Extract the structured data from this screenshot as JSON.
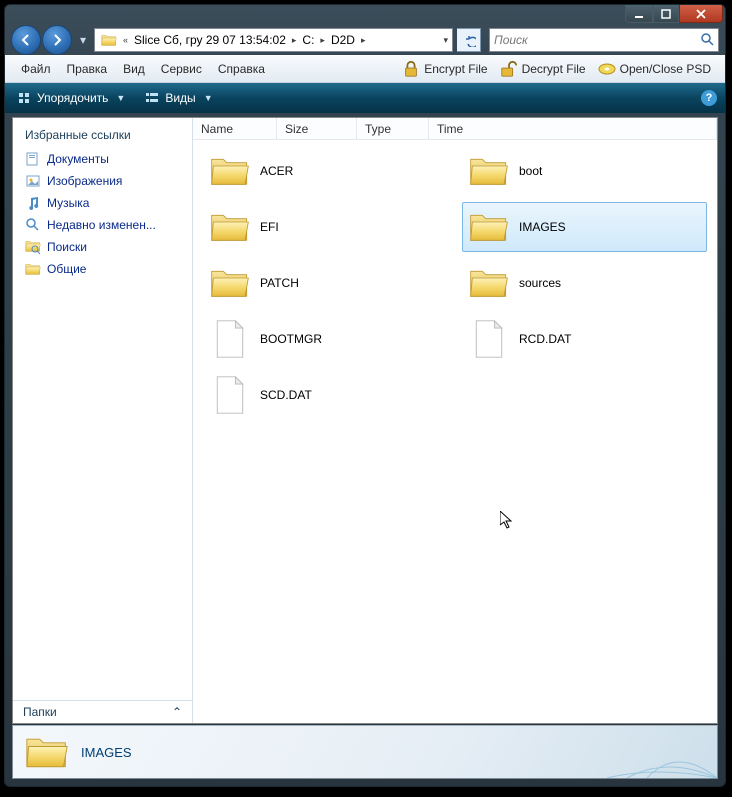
{
  "breadcrumb": {
    "prefix_label": "Slice Сб, гру 29 07 13:54:02",
    "parts": [
      "C:",
      "D2D"
    ]
  },
  "search": {
    "placeholder": "Поиск"
  },
  "menubar": [
    "Файл",
    "Правка",
    "Вид",
    "Сервис",
    "Справка"
  ],
  "toolbar": {
    "encrypt": "Encrypt File",
    "decrypt": "Decrypt File",
    "psd": "Open/Close PSD"
  },
  "commandbar": {
    "organize": "Упорядочить",
    "views": "Виды"
  },
  "navpane": {
    "header": "Избранные ссылки",
    "items": [
      {
        "label": "Документы",
        "icon": "doc"
      },
      {
        "label": "Изображения",
        "icon": "pic"
      },
      {
        "label": "Музыка",
        "icon": "music"
      },
      {
        "label": "Недавно изменен...",
        "icon": "search"
      },
      {
        "label": "Поиски",
        "icon": "searchf"
      },
      {
        "label": "Общие",
        "icon": "folder"
      }
    ],
    "folders": "Папки"
  },
  "columns": {
    "name": "Name",
    "size": "Size",
    "type": "Type",
    "time": "Time"
  },
  "items": [
    {
      "name": "ACER",
      "type": "folder"
    },
    {
      "name": "boot",
      "type": "folder"
    },
    {
      "name": "EFI",
      "type": "folder"
    },
    {
      "name": "IMAGES",
      "type": "folder",
      "selected": true
    },
    {
      "name": "PATCH",
      "type": "folder"
    },
    {
      "name": "sources",
      "type": "folder"
    },
    {
      "name": "BOOTMGR",
      "type": "file"
    },
    {
      "name": "RCD.DAT",
      "type": "file"
    },
    {
      "name": "SCD.DAT",
      "type": "file"
    }
  ],
  "details": {
    "name": "IMAGES"
  }
}
